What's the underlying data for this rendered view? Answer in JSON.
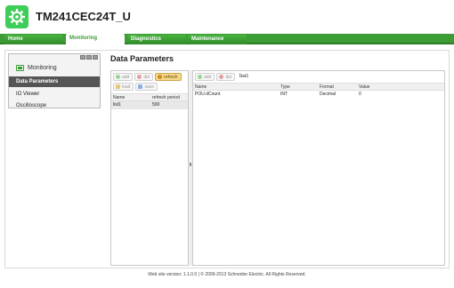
{
  "app": {
    "title": "TM241CEC24T_U",
    "logo_icon": "gear-icon",
    "brand_color": "#3dcd58"
  },
  "nav": {
    "tabs": [
      {
        "label": "Home",
        "active": false
      },
      {
        "label": "Monitoring",
        "active": true
      },
      {
        "label": "Diagnostics",
        "active": false
      },
      {
        "label": "Maintenance",
        "active": false
      }
    ]
  },
  "sidebar": {
    "header": "Monitoring",
    "header_icon": "monitor-icon",
    "items": [
      {
        "label": "Data Parameters",
        "active": true
      },
      {
        "label": "IO Viewer",
        "active": false
      },
      {
        "label": "Oscilloscope",
        "active": false
      }
    ]
  },
  "main": {
    "title": "Data Parameters",
    "lists_panel": {
      "toolbar": {
        "add": "add",
        "del": "del",
        "refresh": "refresh",
        "load": "load",
        "save": "save"
      },
      "columns": [
        "Name",
        "refresh period"
      ],
      "rows": [
        {
          "name": "list1",
          "period": "500"
        }
      ]
    },
    "vars_panel": {
      "toolbar": {
        "add": "add",
        "del": "del"
      },
      "list_name": "list1",
      "columns": [
        "Name",
        "Type",
        "Format",
        "Value"
      ],
      "rows": [
        {
          "name": "POU.dCount",
          "type": "INT",
          "format": "Decimal",
          "value": "0"
        }
      ]
    }
  },
  "footer": {
    "text": "Web site version: 1.1.0.0   |   © 2009-2013 Schneider Electric. All Rights Reserved."
  }
}
